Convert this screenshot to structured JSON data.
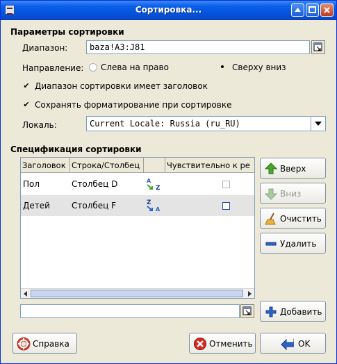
{
  "window": {
    "title": "Сортировка..."
  },
  "params": {
    "section_title": "Параметры сортировки",
    "range_label": "Диапазон:",
    "range_value": "baza!A3:J81",
    "direction_label": "Направление:",
    "direction_left_right": "Слева на право",
    "direction_top_down": "Сверху вниз",
    "selected_direction": "Сверху вниз",
    "has_header_label": "Диапазон сортировки имеет заголовок",
    "has_header_checked": true,
    "keep_format_label": "Сохранять форматирование при сортировке",
    "keep_format_checked": true,
    "locale_label": "Локаль:",
    "locale_value": "Current Locale: Russia (ru_RU)"
  },
  "spec": {
    "section_title": "Спецификация сортировки",
    "columns": [
      "Заголовок",
      "Строка/Столбец",
      "",
      "Чувствительно к ре"
    ],
    "rows": [
      {
        "header": "Пол",
        "column": "Столбец D",
        "order": "ascending",
        "case_sensitive": false
      },
      {
        "header": "Детей",
        "column": "Столбец F",
        "order": "descending",
        "case_sensitive": false
      }
    ],
    "sort_icon_a": "A",
    "sort_icon_z": "Z",
    "add_field_value": ""
  },
  "buttons": {
    "up": "Вверх",
    "down": "Вниз",
    "clear": "Очистить",
    "delete": "Удалить",
    "add": "Добавить",
    "help": "Справка",
    "cancel": "Отменить",
    "ok": "OK"
  },
  "colors": {
    "titlebar": "#0453dd",
    "accent_green": "#4aa52e",
    "accent_blue": "#2a63c8"
  }
}
